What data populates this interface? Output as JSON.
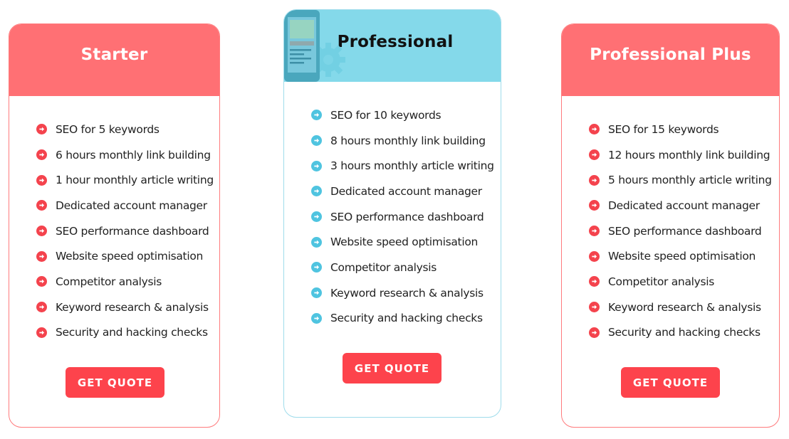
{
  "plans": [
    {
      "name": "Starter",
      "theme": "red",
      "features": [
        "SEO for 5 keywords",
        "6 hours monthly link building",
        "1 hour monthly article writing",
        "Dedicated account manager",
        "SEO performance dashboard",
        "Website speed optimisation",
        "Competitor analysis",
        "Keyword research & analysis",
        "Security and hacking checks"
      ],
      "button_label": "GET QUOTE"
    },
    {
      "name": "Professional",
      "theme": "blue",
      "header_icon": "phone-gear-illustration",
      "features": [
        "SEO for 10 keywords",
        "8 hours monthly link building",
        "3 hours monthly article writing",
        "Dedicated account manager",
        "SEO performance dashboard",
        "Website speed optimisation",
        "Competitor analysis",
        "Keyword research & analysis",
        "Security and hacking checks"
      ],
      "button_label": "GET QUOTE"
    },
    {
      "name": "Professional Plus",
      "theme": "red",
      "features": [
        "SEO for 15 keywords",
        "12 hours monthly link building",
        "5 hours monthly article writing",
        "Dedicated account manager",
        "SEO performance dashboard",
        "Website speed optimisation",
        "Competitor analysis",
        "Keyword research & analysis",
        "Security and hacking checks"
      ],
      "button_label": "GET QUOTE"
    }
  ],
  "bullet_icon": "arrow-right-circle-icon",
  "colors": {
    "red_header": "#ff7074",
    "blue_header": "#84d9ea",
    "button": "#fd434c",
    "red_bullet": "#f4434d",
    "blue_bullet": "#4fc4e0"
  }
}
